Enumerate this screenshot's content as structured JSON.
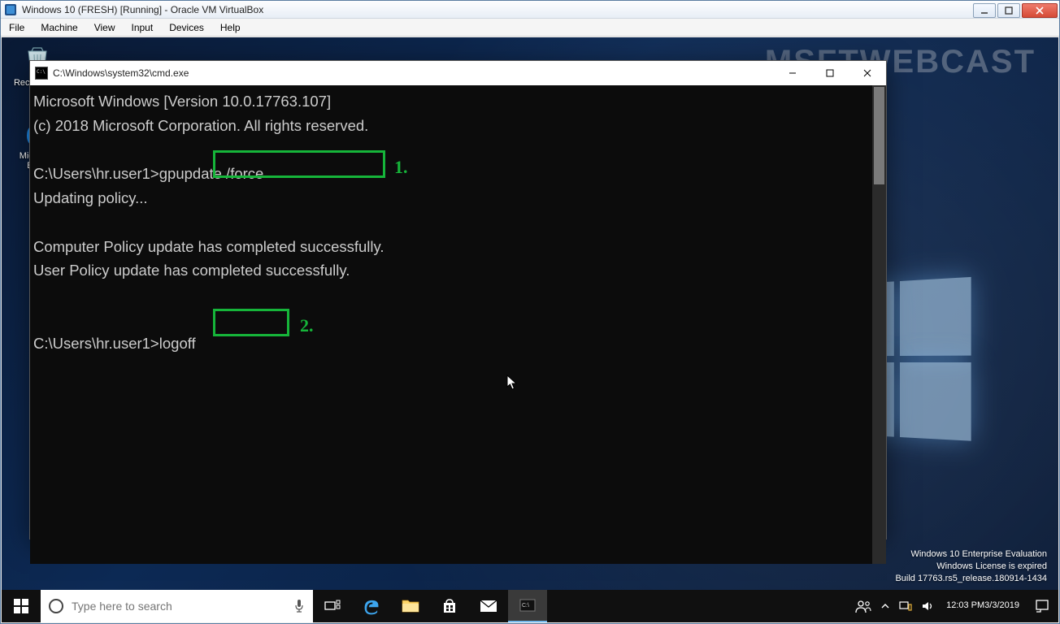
{
  "virtualbox": {
    "title": "Windows 10 (FRESH) [Running] - Oracle VM VirtualBox",
    "menus": [
      "File",
      "Machine",
      "View",
      "Input",
      "Devices",
      "Help"
    ]
  },
  "watermark": "MSFTWEBCAST",
  "desktop_icons": {
    "recycle_bin": "Recycle Bin",
    "edge": "Microsoft Edge"
  },
  "eval": {
    "line1": "Windows 10 Enterprise Evaluation",
    "line2": "Windows License is expired",
    "line3": "Build 17763.rs5_release.180914-1434"
  },
  "taskbar": {
    "search_placeholder": "Type here to search",
    "clock_time": "12:03 PM",
    "clock_date": "3/3/2019"
  },
  "cmd": {
    "title": "C:\\Windows\\system32\\cmd.exe",
    "lines": {
      "l1": "Microsoft Windows [Version 10.0.17763.107]",
      "l2": "(c) 2018 Microsoft Corporation. All rights reserved.",
      "l3": "",
      "l4_prompt": "C:\\Users\\hr.user1>",
      "l4_cmd": "gpupdate /force",
      "l5": "Updating policy...",
      "l6": "",
      "l7": "Computer Policy update has completed successfully.",
      "l8": "User Policy update has completed successfully.",
      "l9": "",
      "l10": "",
      "l11_prompt": "C:\\Users\\hr.user1>",
      "l11_cmd": "logoff"
    }
  },
  "annotations": {
    "a1": "1.",
    "a2": "2."
  }
}
